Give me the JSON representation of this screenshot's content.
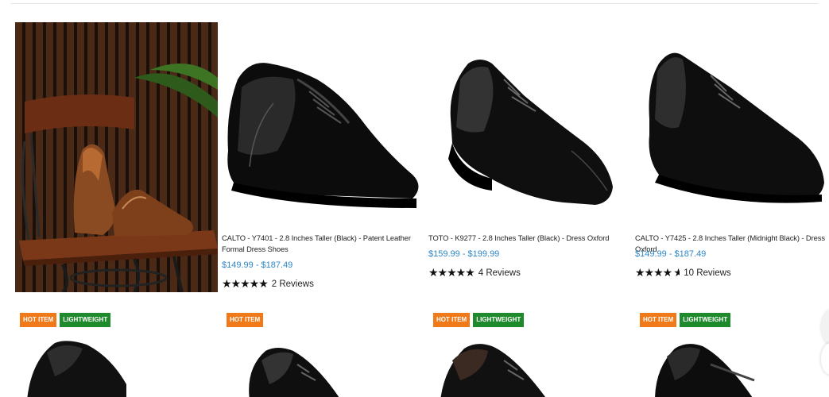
{
  "products_row1": [
    {
      "title": "CALTO - Y7401 - 2.8 Inches Taller (Black) - Patent Leather Formal Dress Shoes",
      "price": "$149.99 - $187.49",
      "stars": "★★★★★",
      "rating": 5,
      "reviews": "2 Reviews"
    },
    {
      "title": "TOTO - K9277 - 2.8 Inches Taller (Black) - Dress Oxford",
      "price": "$159.99 - $199.99",
      "stars": "★★★★★",
      "rating": 5,
      "reviews": "4 Reviews"
    },
    {
      "title": "CALTO - Y7425 - 2.8 Inches Taller (Midnight Black) - Dress Oxford",
      "price": "$149.99 - $187.49",
      "stars": "★★★★",
      "rating": 4.5,
      "reviews": "10 Reviews"
    }
  ],
  "badges": {
    "hot": "HOT ITEM",
    "lightweight": "LIGHTWEIGHT"
  },
  "colors": {
    "price": "#2c86c8",
    "hot_badge": "#f07a1a",
    "lightweight_badge": "#1f8a2c"
  }
}
